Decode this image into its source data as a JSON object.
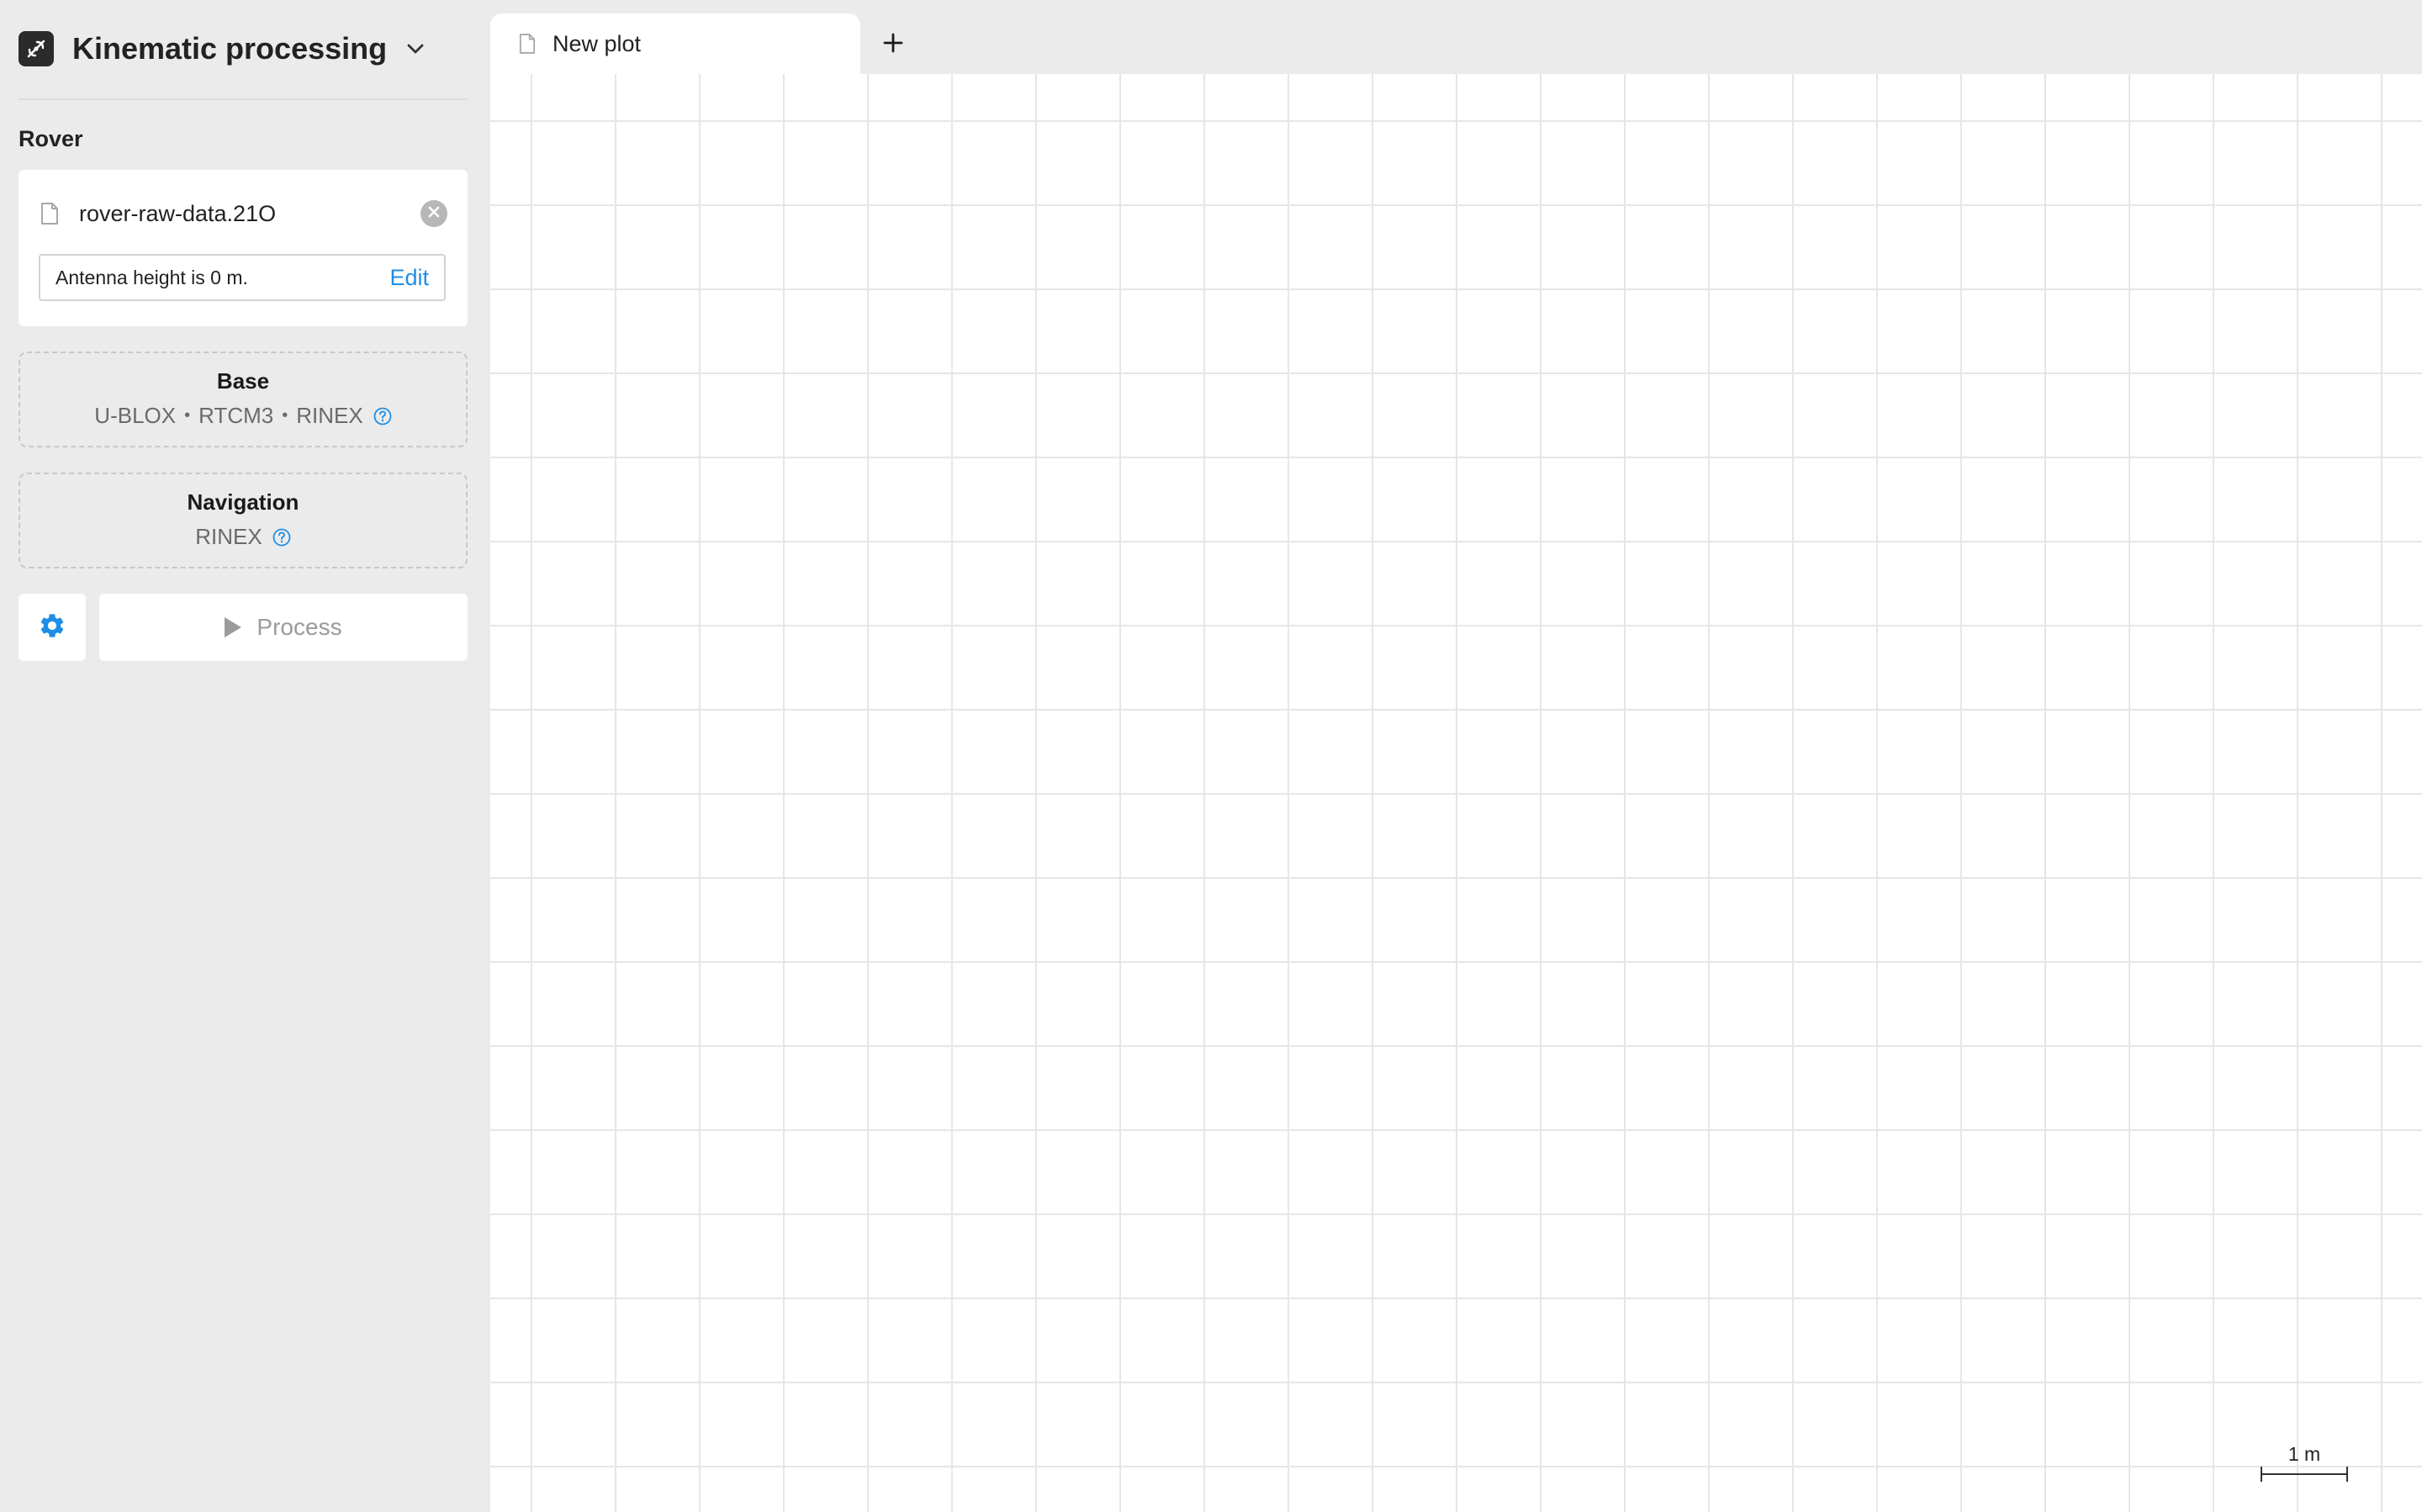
{
  "app": {
    "title": "Kinematic processing",
    "logo_icon": "satellite-link-icon"
  },
  "rover": {
    "label": "Rover",
    "file_name": "rover-raw-data.21O",
    "antenna_text": "Antenna height is 0 m.",
    "edit_label": "Edit"
  },
  "base": {
    "title": "Base",
    "formats": [
      "U-BLOX",
      "RTCM3",
      "RINEX"
    ],
    "separator": "•"
  },
  "navigation": {
    "title": "Navigation",
    "formats": [
      "RINEX"
    ]
  },
  "actions": {
    "process_label": "Process",
    "settings_icon": "gear-icon"
  },
  "tabs": [
    {
      "label": "New plot",
      "active": true
    }
  ],
  "plot": {
    "scale_label": "1 m"
  },
  "colors": {
    "accent": "#1f8ee6",
    "sidebar_bg": "#ebebeb",
    "logo_bg": "#2b2b2b",
    "disabled_text": "#9b9b9b",
    "grid_line": "#e6e6e6"
  }
}
